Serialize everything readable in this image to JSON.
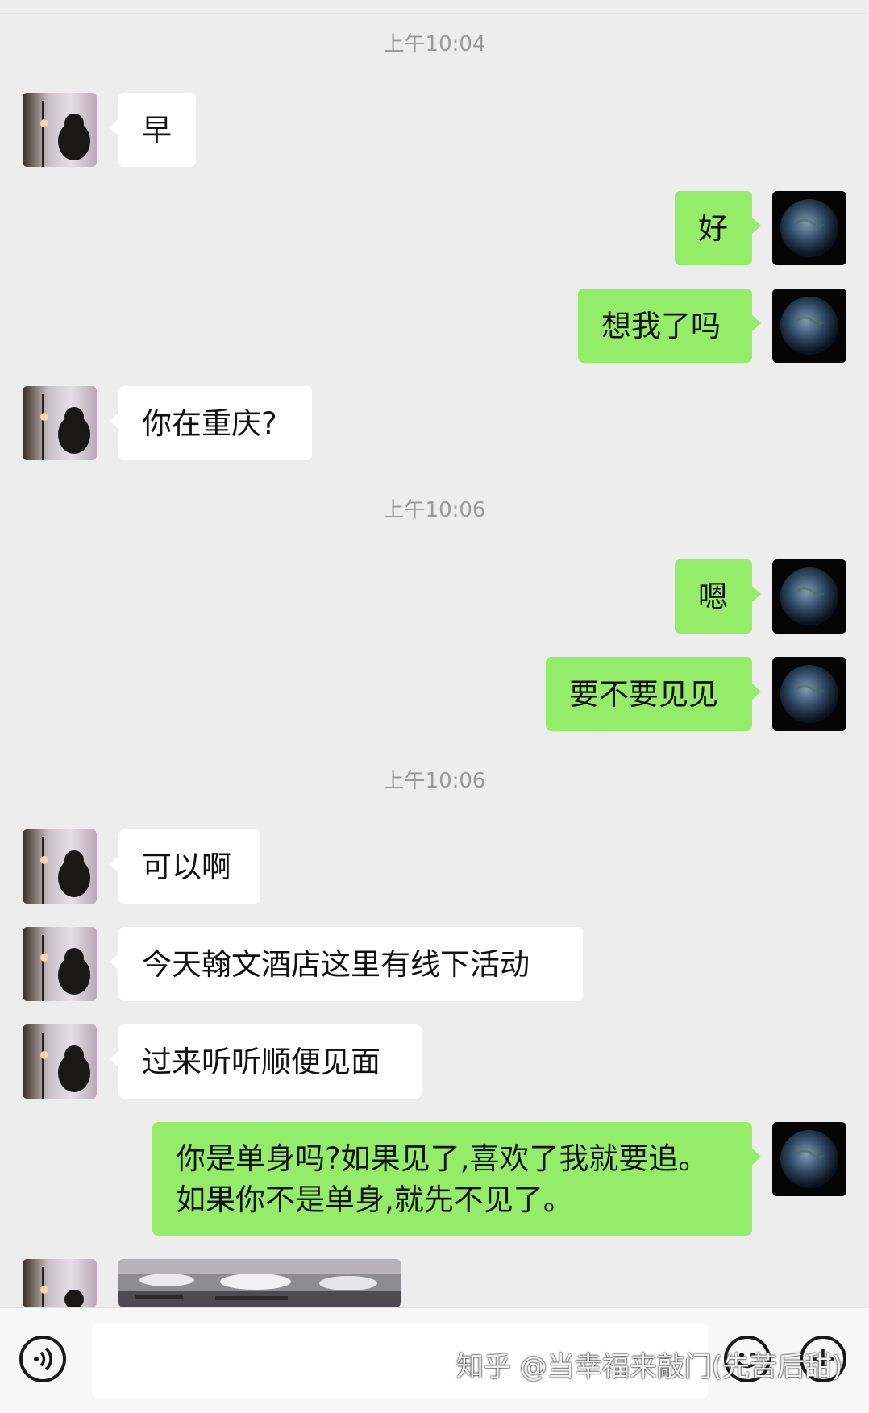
{
  "timestamps": [
    "上午10:04",
    "上午10:06",
    "上午10:06"
  ],
  "messages": [
    {
      "side": "left",
      "text": "早"
    },
    {
      "side": "right",
      "text": "好"
    },
    {
      "side": "right",
      "text": "想我了吗"
    },
    {
      "side": "left",
      "text": "你在重庆?"
    },
    {
      "side": "right",
      "text": "嗯"
    },
    {
      "side": "right",
      "text": "要不要见见"
    },
    {
      "side": "left",
      "text": "可以啊"
    },
    {
      "side": "left",
      "text": "今天翰文酒店这里有线下活动"
    },
    {
      "side": "left",
      "text": "过来听听顺便见面"
    },
    {
      "side": "right",
      "text": "你是单身吗?如果见了,喜欢了我就要追。如果你不是单身,就先不见了。"
    },
    {
      "side": "left",
      "type": "image",
      "text": ""
    }
  ],
  "input": {
    "placeholder": "",
    "value": ""
  },
  "icons": {
    "voice": "voice-icon",
    "emoji": "emoji-icon",
    "plus": "plus-icon",
    "contact_avatar": "contact-avatar",
    "my_avatar": "earth-avatar"
  },
  "colors": {
    "background": "#ededed",
    "sent_bubble": "#95ec69",
    "received_bubble": "#ffffff",
    "timestamp": "#9a9a9a"
  },
  "watermark": "知乎 @当幸福来敲门(先苦后甜)"
}
